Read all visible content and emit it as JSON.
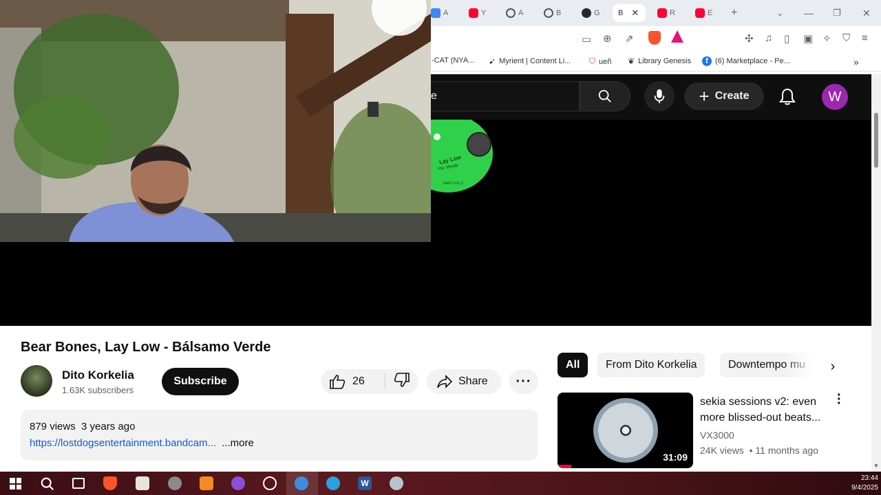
{
  "browser": {
    "tabs": [
      {
        "label": "A",
        "color": "#4285f4"
      },
      {
        "label": "Y",
        "color": "#ff0033"
      },
      {
        "label": "A",
        "color": "#555555"
      },
      {
        "label": "B",
        "color": "#555555"
      },
      {
        "label": "G",
        "color": "#24292f"
      },
      {
        "label": "B",
        "color": "#cccccc"
      },
      {
        "label": "R",
        "color": "#ff0033"
      },
      {
        "label": "E",
        "color": "#ff0033"
      }
    ],
    "bookmarks": [
      {
        "label": "-CAT (NYA...",
        "icon": "none"
      },
      {
        "label": "Myrient | Content Li...",
        "icon": "arrow-icon"
      },
      {
        "label": "ueñ",
        "icon": "shield-icon"
      },
      {
        "label": "Library Genesis",
        "icon": "book-icon"
      },
      {
        "label": "(6) Marketplace - Pe...",
        "icon": "facebook-icon"
      }
    ]
  },
  "youtube": {
    "search_fragment": "e",
    "create_label": "Create",
    "avatar_letter": "W",
    "accent": "#ff0033",
    "avatar_color": "#9c27b0"
  },
  "video": {
    "title": "Bear Bones, Lay Low - Bálsamo Verde",
    "channel": "Dito Korkelia",
    "subscribers": "1.63K subscribers",
    "subscribe_label": "Subscribe",
    "likes": "26",
    "share_label": "Share",
    "views": "879 views",
    "age": "3 years ago",
    "link": "https://lostdogsentertainment.bandcam...",
    "more_label": "...more",
    "record_label_fragment": "Lay Low",
    "record_sub": "mo Verde",
    "record_bottom": "NAKS VOL.2"
  },
  "chips": [
    "All",
    "From Dito Korkelia",
    "Downtempo mu"
  ],
  "recommendation": {
    "title": "sekia sessions v2: even more blissed-out beats...",
    "channel": "VX3000",
    "views": "24K views",
    "age": "11 months ago",
    "duration": "31:09"
  },
  "clock": {
    "time": "23:44",
    "date": "9/4/2025"
  }
}
